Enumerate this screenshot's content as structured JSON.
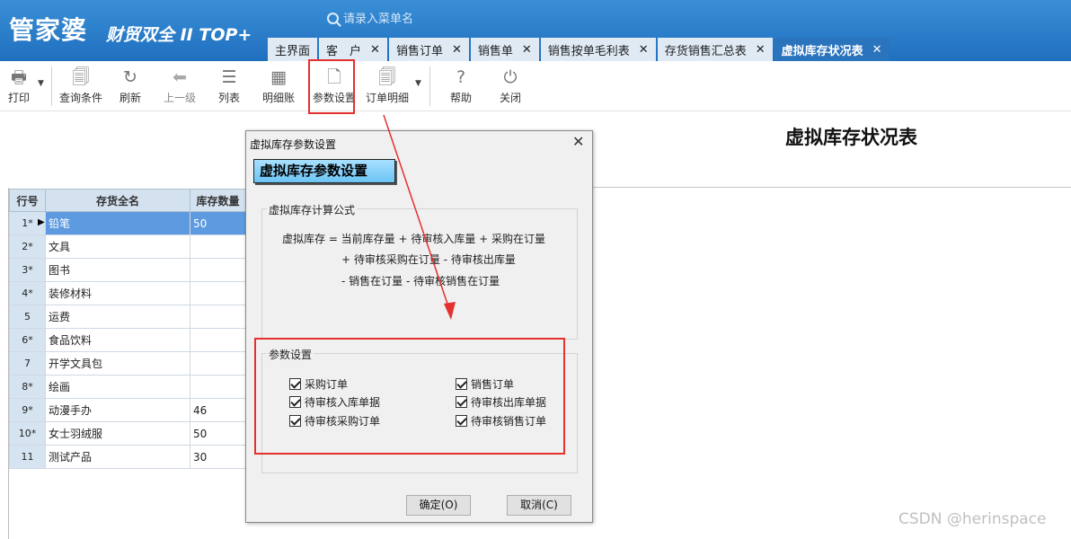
{
  "app": {
    "logo": "管家婆",
    "logo_sub": "财贸双全 II TOP+",
    "search_placeholder": "请录入菜单名"
  },
  "tabs": [
    {
      "label": "主界面",
      "closable": false,
      "active": false
    },
    {
      "label": "客　户",
      "closable": true,
      "active": false
    },
    {
      "label": "销售订单",
      "closable": true,
      "active": false
    },
    {
      "label": "销售单",
      "closable": true,
      "active": false
    },
    {
      "label": "销售按单毛利表",
      "closable": true,
      "active": false
    },
    {
      "label": "存货销售汇总表",
      "closable": true,
      "active": false
    },
    {
      "label": "虚拟库存状况表",
      "closable": true,
      "active": true
    }
  ],
  "toolbar": {
    "print": "打印",
    "query": "查询条件",
    "refresh": "刷新",
    "up": "上一级",
    "list": "列表",
    "detail": "明细账",
    "params": "参数设置",
    "order_detail": "订单明细",
    "help": "帮助",
    "close": "关闭"
  },
  "report": {
    "title": "虚拟库存状况表"
  },
  "grid": {
    "headers": [
      "行号",
      "存货全名",
      "库存数量"
    ],
    "rows": [
      {
        "no": "1*",
        "name": "铅笔",
        "qty": "50",
        "selected": true
      },
      {
        "no": "2*",
        "name": "文具",
        "qty": ""
      },
      {
        "no": "3*",
        "name": "图书",
        "qty": ""
      },
      {
        "no": "4*",
        "name": "装修材料",
        "qty": ""
      },
      {
        "no": "5",
        "name": "运费",
        "qty": ""
      },
      {
        "no": "6*",
        "name": "食品饮料",
        "qty": ""
      },
      {
        "no": "7",
        "name": "开学文具包",
        "qty": ""
      },
      {
        "no": "8*",
        "name": "绘画",
        "qty": ""
      },
      {
        "no": "9*",
        "name": "动漫手办",
        "qty": "46"
      },
      {
        "no": "10*",
        "name": "女士羽绒服",
        "qty": "50"
      },
      {
        "no": "11",
        "name": "测试产品",
        "qty": "30"
      }
    ]
  },
  "dialog": {
    "title": "虚拟库存参数设置",
    "banner": "虚拟库存参数设置",
    "formula_legend": "虚拟库存计算公式",
    "formula_line1": "虚拟库存 = 当前库存量 + 待审核入库量 + 采购在订量",
    "formula_line2": "+ 待审核采购在订量 - 待审核出库量",
    "formula_line3": "- 销售在订量 - 待审核销售在订量",
    "params_legend": "参数设置",
    "checkboxes": [
      {
        "label": "采购订单",
        "checked": true
      },
      {
        "label": "销售订单",
        "checked": true
      },
      {
        "label": "待审核入库单据",
        "checked": true
      },
      {
        "label": "待审核出库单据",
        "checked": true
      },
      {
        "label": "待审核采购订单",
        "checked": true
      },
      {
        "label": "待审核销售订单",
        "checked": true
      }
    ],
    "ok": "确定(O)",
    "cancel": "取消(C)"
  },
  "watermark": "CSDN @herinspace",
  "colors": {
    "header_blue": "#1f6fbf",
    "active_tab": "#2a73bd",
    "selected_row": "#5d9ae0",
    "annotation_red": "#e53030"
  }
}
